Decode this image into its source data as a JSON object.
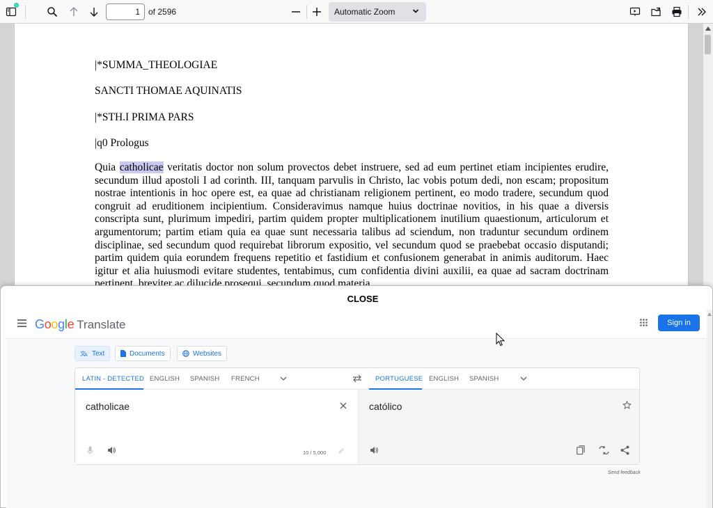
{
  "toolbar": {
    "page_number": "1",
    "page_count": "of 2596",
    "zoom_selected": "Automatic Zoom",
    "icons": [
      "sidebar-toggle-icon",
      "search-icon",
      "previous-page-icon",
      "next-page-icon",
      "zoom-out-icon",
      "zoom-in-icon",
      "presentation-mode-icon",
      "open-file-icon",
      "print-icon",
      "tools-icon"
    ]
  },
  "document": {
    "lines": [
      "|*SUMMA_THEOLOGIAE",
      "SANCTI THOMAE AQUINATIS",
      "|*STH.I   PRIMA PARS",
      "|q0   Prologus"
    ],
    "para_before": "Quia ",
    "highlighted_word": "catholicae",
    "para_after": " veritatis doctor non solum provectos debet instruere, sed ad eum pertinet etiam incipientes erudire, secundum illud apostoli I ad corinth. III, tanquam parvulis in Christo, lac vobis potum dedi, non escam; propositum nostrae intentionis in hoc opere est, ea quae ad christianam religionem pertinent, eo modo tradere, secundum quod congruit ad eruditionem incipientium. Consideravimus namque huius doctrinae novitios, in his quae a diversis conscripta sunt, plurimum impediri, partim quidem propter multiplicationem inutilium quaestionum, articulorum et argumentorum; partim etiam quia ea quae sunt necessaria talibus ad sciendum, non traduntur secundum ordinem disciplinae, sed secundum quod requirebat librorum expositio, vel secundum quod se praebebat occasio disputandi; partim quidem quia eorundem frequens repetitio et fastidium et confusionem generabat in animis auditorum. Haec igitur et alia huiusmodi evitare studentes, tentabimus, cum confidentia divini auxilii, ea quae ad sacram doctrinam pertinent, breviter ac dilucide prosequi, secundum quod materia"
  },
  "overlay": {
    "close_label": "CLOSE",
    "logo_text": "Google",
    "product": "Translate",
    "sign_in": "Sign in",
    "modes": [
      "Text",
      "Documents",
      "Websites"
    ],
    "source_langs": [
      "LATIN - DETECTED",
      "ENGLISH",
      "SPANISH",
      "FRENCH"
    ],
    "target_langs": [
      "PORTUGUESE",
      "ENGLISH",
      "SPANISH"
    ],
    "source_text": "catholicae",
    "target_text": "católico",
    "char_counter": "10 / 5,000",
    "send_feedback": "Send feedback"
  },
  "colors": {
    "accent": "#1a73e8",
    "highlight": "#c8c8f0",
    "google_blue": "#4285f4",
    "google_red": "#ea4335",
    "google_yellow": "#fbbc05",
    "google_green": "#34a853"
  }
}
